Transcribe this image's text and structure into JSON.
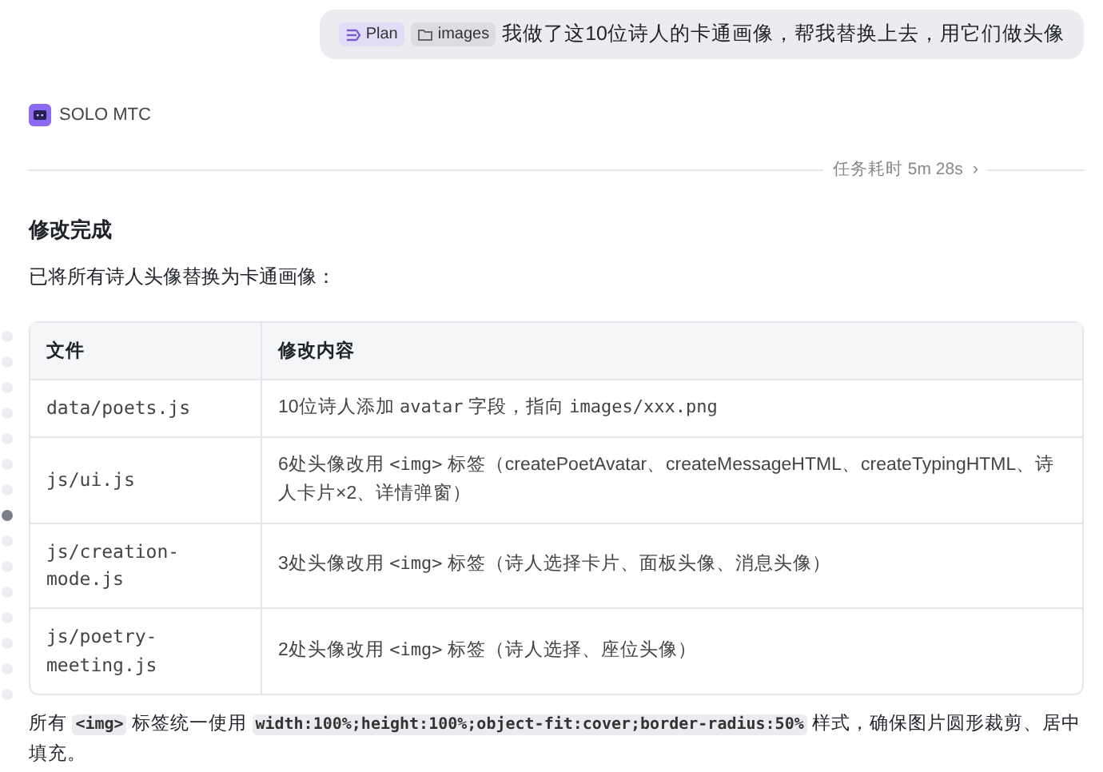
{
  "user_message": {
    "chips": [
      {
        "kind": "plan",
        "label": "Plan"
      },
      {
        "kind": "folder",
        "label": "images"
      }
    ],
    "text": "我做了这10位诗人的卡通画像，帮我替换上去，用它们做头像"
  },
  "agent": {
    "name": "SOLO MTC"
  },
  "duration": {
    "label": "任务耗时 5m 28s",
    "chevron": "›"
  },
  "heading": "修改完成",
  "intro": "已将所有诗人头像替换为卡通画像：",
  "table": {
    "columns": [
      "文件",
      "修改内容"
    ],
    "rows": [
      {
        "file": "data/poets.js",
        "change": [
          {
            "kind": "text",
            "text": "10位诗人添加 "
          },
          {
            "kind": "code",
            "text": "avatar"
          },
          {
            "kind": "text",
            "text": " 字段，指向 "
          },
          {
            "kind": "code",
            "text": "images/xxx.png"
          }
        ]
      },
      {
        "file": "js/ui.js",
        "change": [
          {
            "kind": "text",
            "text": "6处头像改用 "
          },
          {
            "kind": "code",
            "text": "<img>"
          },
          {
            "kind": "text",
            "text": " 标签（createPoetAvatar、createMessageHTML、createTypingHTML、诗人卡片×2、详情弹窗）"
          }
        ]
      },
      {
        "file": "js/creation-mode.js",
        "change": [
          {
            "kind": "text",
            "text": "3处头像改用 "
          },
          {
            "kind": "code",
            "text": "<img>"
          },
          {
            "kind": "text",
            "text": " 标签（诗人选择卡片、面板头像、消息头像）"
          }
        ]
      },
      {
        "file": "js/poetry-meeting.js",
        "change": [
          {
            "kind": "text",
            "text": "2处头像改用 "
          },
          {
            "kind": "code",
            "text": "<img>"
          },
          {
            "kind": "text",
            "text": " 标签（诗人选择、座位头像）"
          }
        ]
      }
    ]
  },
  "footer": [
    {
      "kind": "text",
      "text": "所有 "
    },
    {
      "kind": "chip",
      "text": "<img>"
    },
    {
      "kind": "text",
      "text": " 标签统一使用 "
    },
    {
      "kind": "chip",
      "text": "width:100%;height:100%;object-fit:cover;border-radius:50%"
    },
    {
      "kind": "text",
      "text": " 样式，确保图片圆形裁剪、居中填充。"
    }
  ],
  "outline_dots": [
    {
      "selected": false
    },
    {
      "selected": false
    },
    {
      "selected": false
    },
    {
      "selected": false
    },
    {
      "selected": false
    },
    {
      "selected": false
    },
    {
      "selected": false
    },
    {
      "selected": true
    },
    {
      "selected": false
    },
    {
      "selected": false
    },
    {
      "selected": false
    },
    {
      "selected": false
    },
    {
      "selected": false
    },
    {
      "selected": false
    },
    {
      "selected": false
    }
  ]
}
